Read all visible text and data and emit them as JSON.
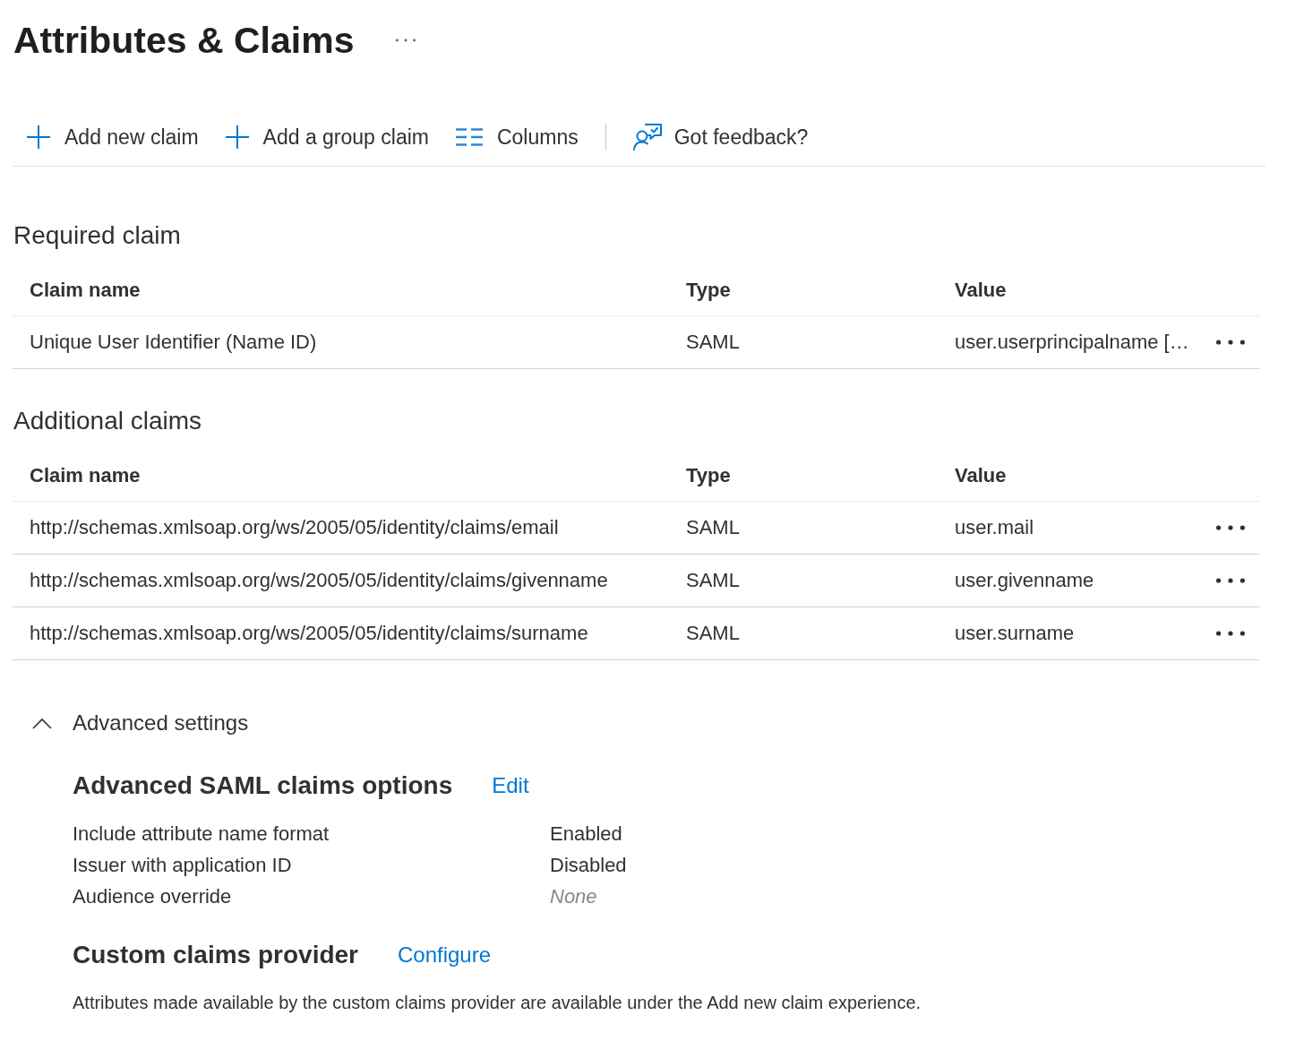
{
  "page": {
    "title": "Attributes & Claims"
  },
  "toolbar": {
    "actions": [
      {
        "label": "Add new claim",
        "kind": "add"
      },
      {
        "label": "Add a group claim",
        "kind": "add"
      },
      {
        "label": "Columns",
        "kind": "columns"
      }
    ],
    "feedback": {
      "label": "Got feedback?"
    }
  },
  "required_claim": {
    "heading": "Required claim",
    "columns": [
      "Claim name",
      "Type",
      "Value"
    ],
    "rows": [
      {
        "claim_name": "Unique User Identifier (Name ID)",
        "type": "SAML",
        "value": "user.userprincipalname […"
      }
    ]
  },
  "additional_claims": {
    "heading": "Additional claims",
    "columns": [
      "Claim name",
      "Type",
      "Value"
    ],
    "rows": [
      {
        "claim_name": "http://schemas.xmlsoap.org/ws/2005/05/identity/claims/email",
        "type": "SAML",
        "value": "user.mail"
      },
      {
        "claim_name": "http://schemas.xmlsoap.org/ws/2005/05/identity/claims/givenname",
        "type": "SAML",
        "value": "user.givenname"
      },
      {
        "claim_name": "http://schemas.xmlsoap.org/ws/2005/05/identity/claims/surname",
        "type": "SAML",
        "value": "user.surname"
      }
    ]
  },
  "advanced_settings": {
    "label": "Advanced settings",
    "expanded": true,
    "saml_options": {
      "heading": "Advanced SAML claims options",
      "link": "Edit",
      "rows": [
        {
          "label": "Include attribute name format",
          "value": "Enabled",
          "kind": "set"
        },
        {
          "label": "Issuer with application ID",
          "value": "Disabled",
          "kind": "set"
        },
        {
          "label": "Audience override",
          "value": "None",
          "kind": "unset"
        }
      ]
    },
    "custom_claims_provider": {
      "heading": "Custom claims provider",
      "link": "Configure",
      "description": "Attributes made available by the custom claims provider are available under the Add new claim experience."
    }
  }
}
